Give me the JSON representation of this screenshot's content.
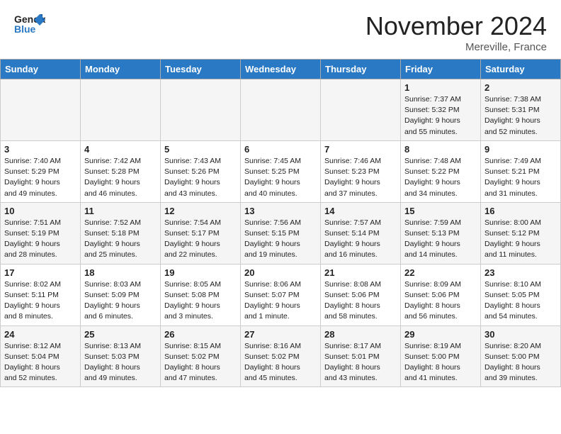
{
  "header": {
    "logo_line1": "General",
    "logo_line2": "Blue",
    "month": "November 2024",
    "location": "Mereville, France"
  },
  "weekdays": [
    "Sunday",
    "Monday",
    "Tuesday",
    "Wednesday",
    "Thursday",
    "Friday",
    "Saturday"
  ],
  "weeks": [
    [
      {
        "day": "",
        "info": ""
      },
      {
        "day": "",
        "info": ""
      },
      {
        "day": "",
        "info": ""
      },
      {
        "day": "",
        "info": ""
      },
      {
        "day": "",
        "info": ""
      },
      {
        "day": "1",
        "info": "Sunrise: 7:37 AM\nSunset: 5:32 PM\nDaylight: 9 hours\nand 55 minutes."
      },
      {
        "day": "2",
        "info": "Sunrise: 7:38 AM\nSunset: 5:31 PM\nDaylight: 9 hours\nand 52 minutes."
      }
    ],
    [
      {
        "day": "3",
        "info": "Sunrise: 7:40 AM\nSunset: 5:29 PM\nDaylight: 9 hours\nand 49 minutes."
      },
      {
        "day": "4",
        "info": "Sunrise: 7:42 AM\nSunset: 5:28 PM\nDaylight: 9 hours\nand 46 minutes."
      },
      {
        "day": "5",
        "info": "Sunrise: 7:43 AM\nSunset: 5:26 PM\nDaylight: 9 hours\nand 43 minutes."
      },
      {
        "day": "6",
        "info": "Sunrise: 7:45 AM\nSunset: 5:25 PM\nDaylight: 9 hours\nand 40 minutes."
      },
      {
        "day": "7",
        "info": "Sunrise: 7:46 AM\nSunset: 5:23 PM\nDaylight: 9 hours\nand 37 minutes."
      },
      {
        "day": "8",
        "info": "Sunrise: 7:48 AM\nSunset: 5:22 PM\nDaylight: 9 hours\nand 34 minutes."
      },
      {
        "day": "9",
        "info": "Sunrise: 7:49 AM\nSunset: 5:21 PM\nDaylight: 9 hours\nand 31 minutes."
      }
    ],
    [
      {
        "day": "10",
        "info": "Sunrise: 7:51 AM\nSunset: 5:19 PM\nDaylight: 9 hours\nand 28 minutes."
      },
      {
        "day": "11",
        "info": "Sunrise: 7:52 AM\nSunset: 5:18 PM\nDaylight: 9 hours\nand 25 minutes."
      },
      {
        "day": "12",
        "info": "Sunrise: 7:54 AM\nSunset: 5:17 PM\nDaylight: 9 hours\nand 22 minutes."
      },
      {
        "day": "13",
        "info": "Sunrise: 7:56 AM\nSunset: 5:15 PM\nDaylight: 9 hours\nand 19 minutes."
      },
      {
        "day": "14",
        "info": "Sunrise: 7:57 AM\nSunset: 5:14 PM\nDaylight: 9 hours\nand 16 minutes."
      },
      {
        "day": "15",
        "info": "Sunrise: 7:59 AM\nSunset: 5:13 PM\nDaylight: 9 hours\nand 14 minutes."
      },
      {
        "day": "16",
        "info": "Sunrise: 8:00 AM\nSunset: 5:12 PM\nDaylight: 9 hours\nand 11 minutes."
      }
    ],
    [
      {
        "day": "17",
        "info": "Sunrise: 8:02 AM\nSunset: 5:11 PM\nDaylight: 9 hours\nand 8 minutes."
      },
      {
        "day": "18",
        "info": "Sunrise: 8:03 AM\nSunset: 5:09 PM\nDaylight: 9 hours\nand 6 minutes."
      },
      {
        "day": "19",
        "info": "Sunrise: 8:05 AM\nSunset: 5:08 PM\nDaylight: 9 hours\nand 3 minutes."
      },
      {
        "day": "20",
        "info": "Sunrise: 8:06 AM\nSunset: 5:07 PM\nDaylight: 9 hours\nand 1 minute."
      },
      {
        "day": "21",
        "info": "Sunrise: 8:08 AM\nSunset: 5:06 PM\nDaylight: 8 hours\nand 58 minutes."
      },
      {
        "day": "22",
        "info": "Sunrise: 8:09 AM\nSunset: 5:06 PM\nDaylight: 8 hours\nand 56 minutes."
      },
      {
        "day": "23",
        "info": "Sunrise: 8:10 AM\nSunset: 5:05 PM\nDaylight: 8 hours\nand 54 minutes."
      }
    ],
    [
      {
        "day": "24",
        "info": "Sunrise: 8:12 AM\nSunset: 5:04 PM\nDaylight: 8 hours\nand 52 minutes."
      },
      {
        "day": "25",
        "info": "Sunrise: 8:13 AM\nSunset: 5:03 PM\nDaylight: 8 hours\nand 49 minutes."
      },
      {
        "day": "26",
        "info": "Sunrise: 8:15 AM\nSunset: 5:02 PM\nDaylight: 8 hours\nand 47 minutes."
      },
      {
        "day": "27",
        "info": "Sunrise: 8:16 AM\nSunset: 5:02 PM\nDaylight: 8 hours\nand 45 minutes."
      },
      {
        "day": "28",
        "info": "Sunrise: 8:17 AM\nSunset: 5:01 PM\nDaylight: 8 hours\nand 43 minutes."
      },
      {
        "day": "29",
        "info": "Sunrise: 8:19 AM\nSunset: 5:00 PM\nDaylight: 8 hours\nand 41 minutes."
      },
      {
        "day": "30",
        "info": "Sunrise: 8:20 AM\nSunset: 5:00 PM\nDaylight: 8 hours\nand 39 minutes."
      }
    ]
  ]
}
